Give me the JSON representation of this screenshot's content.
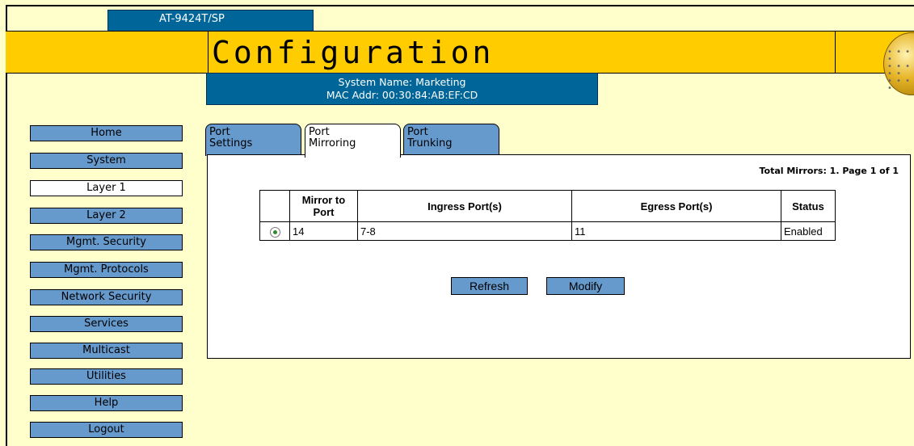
{
  "header": {
    "model": "AT-9424T/SP",
    "title": "Configuration",
    "system_name": "System Name: Marketing",
    "mac_addr": "MAC Addr: 00:30:84:AB:EF:CD"
  },
  "sidebar": {
    "items": [
      {
        "label": "Home"
      },
      {
        "label": "System"
      },
      {
        "label": "Layer 1",
        "active": true
      },
      {
        "label": "Layer 2"
      },
      {
        "label": "Mgmt. Security"
      },
      {
        "label": "Mgmt. Protocols"
      },
      {
        "label": "Network Security"
      },
      {
        "label": "Services"
      },
      {
        "label": "Multicast"
      },
      {
        "label": "Utilities"
      },
      {
        "label": "Help"
      },
      {
        "label": "Logout"
      }
    ]
  },
  "tabs": [
    {
      "line1": "Port",
      "line2": "Settings"
    },
    {
      "line1": "Port",
      "line2": "Mirroring",
      "active": true
    },
    {
      "line1": "Port",
      "line2": "Trunking"
    }
  ],
  "panel": {
    "total_mirrors": "Total Mirrors: 1. Page 1 of 1",
    "table": {
      "columns": [
        "",
        "Mirror to Port",
        "Ingress Port(s)",
        "Egress Port(s)",
        "Status"
      ],
      "col_mirror_line1": "Mirror to",
      "col_mirror_line2": "Port",
      "rows": [
        {
          "selected": true,
          "mirror_to_port": "14",
          "ingress": "7-8",
          "egress": "11",
          "status": "Enabled"
        }
      ]
    },
    "buttons": {
      "refresh": "Refresh",
      "modify": "Modify"
    }
  },
  "colors": {
    "background": "#ffffcc",
    "header_band": "#ffcc00",
    "header_box": "#006699",
    "nav_button": "#6699cc",
    "radio_selected": "#2d8a2d"
  },
  "icons": {
    "logo": "globe-logo-icon",
    "radio": "radio-selected-icon"
  }
}
